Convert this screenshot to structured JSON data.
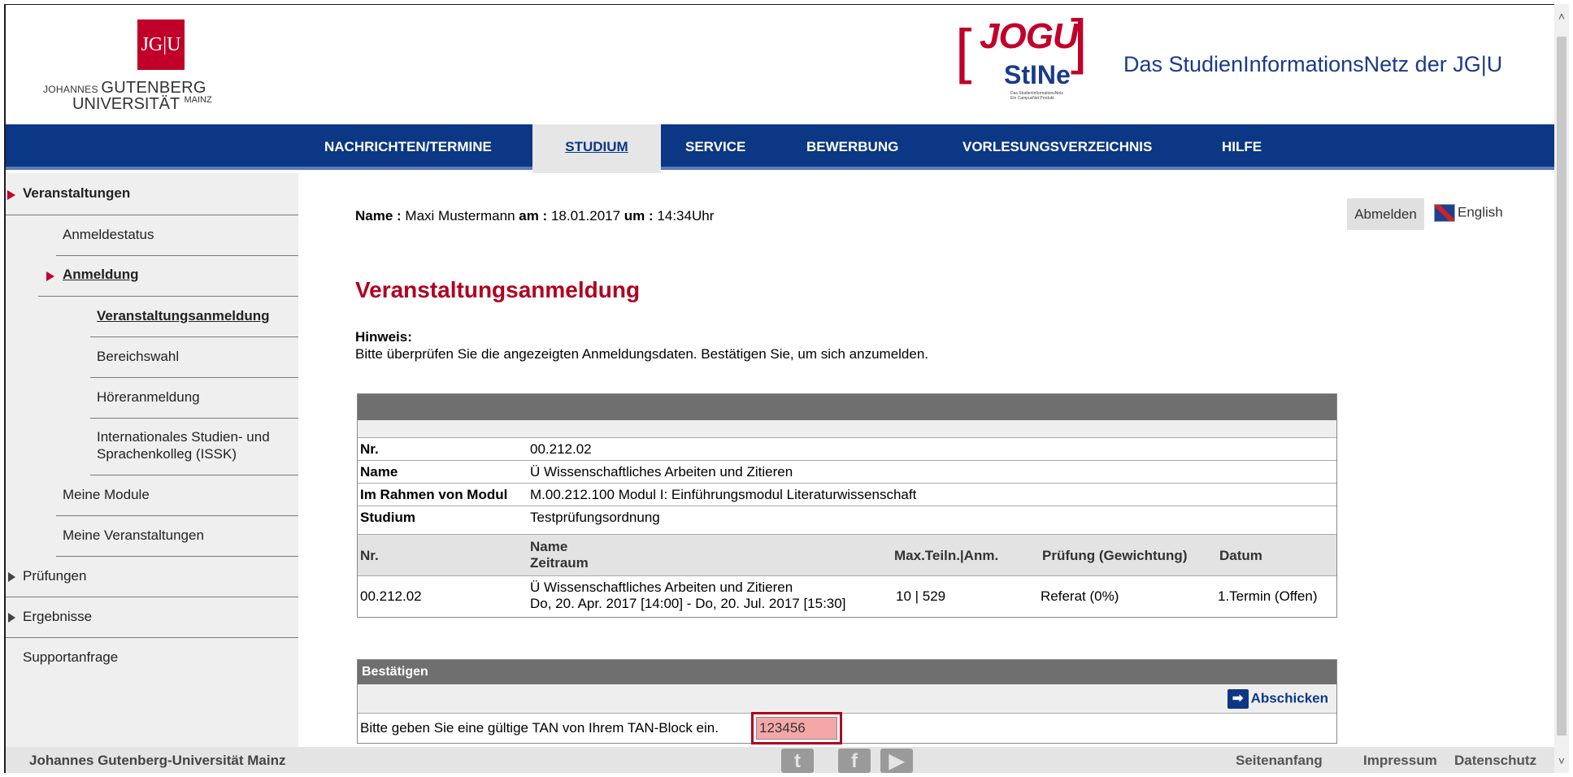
{
  "header": {
    "jgu_box": "JG|U",
    "jgu_line1_small": "JOHANNES",
    "jgu_line1_big": "GUTENBERG",
    "jgu_line2_big": "UNIVERSITÄT",
    "jgu_line2_small": "MAINZ",
    "stine_jogu": "JOGU",
    "stine_stine": "StINe",
    "stine_sub1": "Das StudienInformationsNetz",
    "stine_sub2": "Ein CampusNet Produkt",
    "site_title": "Das StudienInformationsNetz der JG|U"
  },
  "nav": {
    "items": [
      "NACHRICHTEN/TERMINE",
      "STUDIUM",
      "SERVICE",
      "BEWERBUNG",
      "VORLESUNGSVERZEICHNIS",
      "HILFE"
    ],
    "active": "STUDIUM"
  },
  "sidebar": {
    "items": [
      "Veranstaltungen",
      "Anmeldestatus",
      "Anmeldung",
      "Veranstaltungsanmeldung",
      "Bereichswahl",
      "Höreranmeldung",
      "Internationales Studien- und",
      "Sprachenkolleg (ISSK)",
      "Meine Module",
      "Meine Veranstaltungen",
      "Prüfungen",
      "Ergebnisse",
      "Supportanfrage"
    ]
  },
  "user": {
    "name_label": "Name :",
    "name": "Maxi Mustermann",
    "date_label": "am :",
    "date": "18.01.2017",
    "time_label": "um :",
    "time": "14:34Uhr",
    "logout": "Abmelden",
    "language": "English"
  },
  "main": {
    "title": "Veranstaltungsanmeldung",
    "hint_label": "Hinweis:",
    "hint_text": "Bitte überprüfen Sie die angezeigten Anmeldungsdaten. Bestätigen Sie, um sich anzumelden."
  },
  "details": {
    "nr_label": "Nr.",
    "nr": "00.212.02",
    "name_label": "Name",
    "name": "Ü Wissenschaftliches Arbeiten und Zitieren",
    "modul_label": "Im Rahmen von Modul",
    "modul": "M.00.212.100 Modul I: Einführungsmodul Literaturwissenschaft",
    "studium_label": "Studium",
    "studium": "Testprüfungsordnung"
  },
  "table": {
    "headers": {
      "nr": "Nr.",
      "name": "Name",
      "zeitraum": "Zeitraum",
      "max": "Max.Teiln.|Anm.",
      "pruefung": "Prüfung  (Gewichtung)",
      "datum": "Datum"
    },
    "row": {
      "nr": "00.212.02",
      "name": "Ü Wissenschaftliches Arbeiten und Zitieren",
      "zeitraum": "Do, 20. Apr. 2017 [14:00] - Do, 20. Jul. 2017 [15:30]",
      "max": "10 | 529",
      "pruefung": "Referat (0%)",
      "datum": "1.Termin (Offen)"
    }
  },
  "confirm": {
    "title": "Bestätigen",
    "submit": "Abschicken",
    "tan_label": "Bitte geben Sie eine gültige TAN von Ihrem TAN-Block ein.",
    "tan_value": "123456"
  },
  "footer": {
    "university": "Johannes Gutenberg-Universität Mainz",
    "links": [
      "Seitenanfang",
      "Impressum",
      "Datenschutz"
    ]
  }
}
